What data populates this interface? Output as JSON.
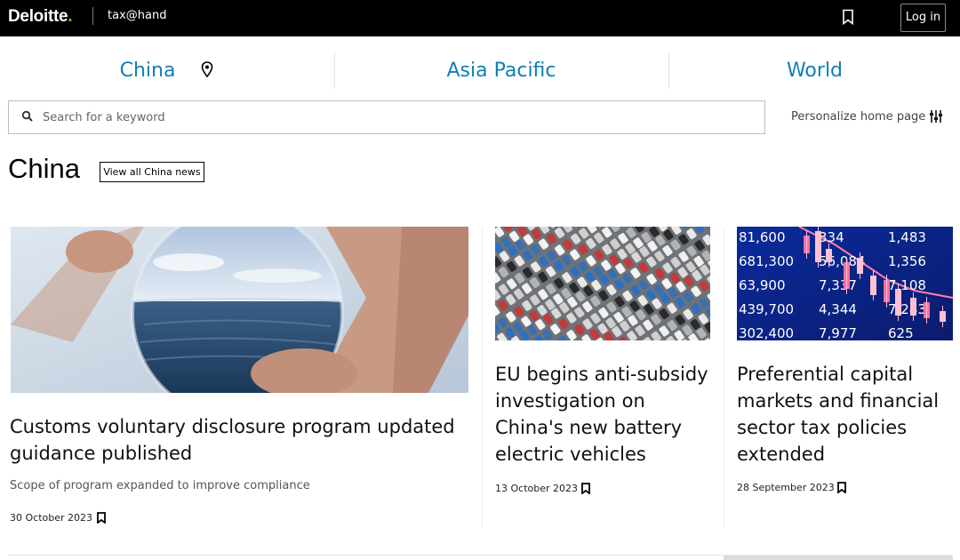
{
  "header": {
    "logo_text": "Deloitte",
    "logo_dot": ".",
    "brand": "tax@hand",
    "login_label": "Log in",
    "accent_color": "#86bc25"
  },
  "regions": {
    "tabs": [
      {
        "label": "China",
        "icon": "location-pin-icon"
      },
      {
        "label": "Asia Pacific"
      },
      {
        "label": "World"
      }
    ],
    "link_color": "#0f7fb5"
  },
  "search": {
    "placeholder": "Search for a keyword",
    "value": ""
  },
  "personalize": {
    "label": "Personalize home page",
    "icon": "sliders-icon"
  },
  "section": {
    "title": "China",
    "view_all_label": "View all China news"
  },
  "articles": [
    {
      "title": "Customs voluntary disclosure program updated guidance published",
      "subtitle": "Scope of program expanded to improve compliance",
      "date": "30 October 2023",
      "image": "crystal-ball-ocean"
    },
    {
      "title": "EU begins anti-subsidy investigation on China's new battery electric vehicles",
      "date": "13 October 2023",
      "image": "parked-cars-aerial"
    },
    {
      "title": "Preferential capital markets and financial sector tax policies extended",
      "date": "28 September 2023",
      "image": "stock-market-board",
      "ticker_values": [
        "81,600",
        "334",
        "1,483",
        "681,300",
        "56,084",
        "1,356",
        "63,900",
        "7,337",
        "7,108",
        "439,700",
        "4,344",
        "7,243",
        "302,400",
        "7,977",
        "625"
      ]
    }
  ]
}
